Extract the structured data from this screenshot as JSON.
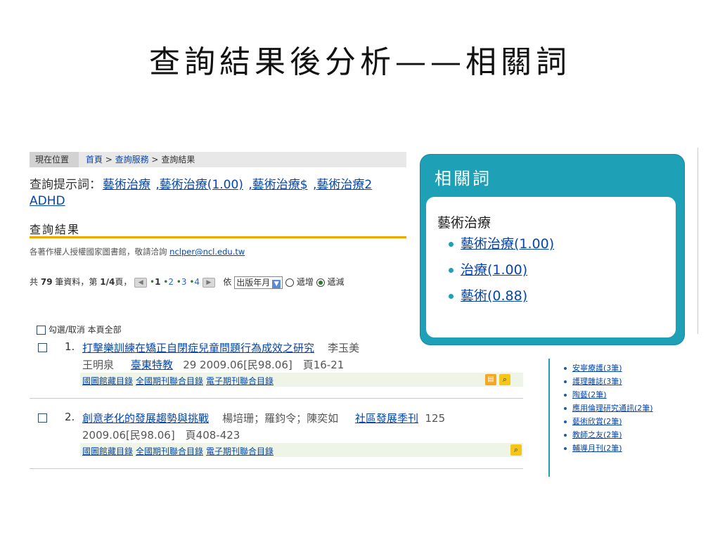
{
  "slide_title": "查詢結果後分析——相關詞",
  "breadcrumb": {
    "here": "現在位置",
    "home": "首頁",
    "service": "查詢服務",
    "result": "查詢結果",
    "sep": ">"
  },
  "hint": {
    "label": "查詢提示詞：",
    "terms": [
      "藝術治療",
      ",藝術治療(1.00)",
      ",藝術治療$",
      ",藝術治療2"
    ],
    "term2": "ADHD"
  },
  "results_title": "查詢結果",
  "rights": {
    "text": "各著作權人授權國家圖書館，敬請洽詢",
    "email": "nclper@ncl.edu.tw"
  },
  "pager": {
    "prefix": "共",
    "total": "79",
    "mid": "筆資料，第",
    "page": "1/4",
    "suffix": "頁，",
    "pages": [
      "1",
      "2",
      "3",
      "4"
    ],
    "sort_label": "依",
    "sort_value": "出版年月",
    "radio_inc": "遞增",
    "radio_dec": "遞減"
  },
  "select_all": "勾選/取消 本頁全部",
  "records": [
    {
      "num": "1.",
      "title": "打擊樂訓練在矯正自閉症兒童問題行為成效之研究",
      "authors1": "李玉美",
      "authors2": "王明泉",
      "journal": "臺東特教",
      "tail": "29 2009.06[民98.06]　頁16-21",
      "catalogs": [
        "國圖館藏目錄",
        "全國期刊聯合目錄",
        "電子期刊聯合目錄"
      ]
    },
    {
      "num": "2.",
      "title": "創意老化的發展趨勢與挑戰",
      "authors1": "楊培珊；羅鈞令；陳奕如",
      "journal": "社區發展季刊",
      "vol": "125",
      "tail": "2009.06[民98.06]　頁408-423",
      "catalogs": [
        "國圖館藏目錄",
        "全國期刊聯合目錄",
        "電子期刊聯合目錄"
      ]
    }
  ],
  "popup": {
    "title": "相關詞",
    "head": "藝術治療",
    "items": [
      "藝術治療(1.00)",
      "治療(1.00)",
      "藝術(0.88)"
    ]
  },
  "sidebar_items": [
    "安寧療護(3筆)",
    "護理雜誌(3筆)",
    "陶藝(2筆)",
    "應用倫理研究通訊(2筆)",
    "藝術欣賞(2筆)",
    "教師之友(2筆)",
    "輔導月刊(2筆)"
  ],
  "colors": {
    "accent": "#1ea0b7",
    "link": "#0645ad",
    "orange": "#f0a500"
  }
}
